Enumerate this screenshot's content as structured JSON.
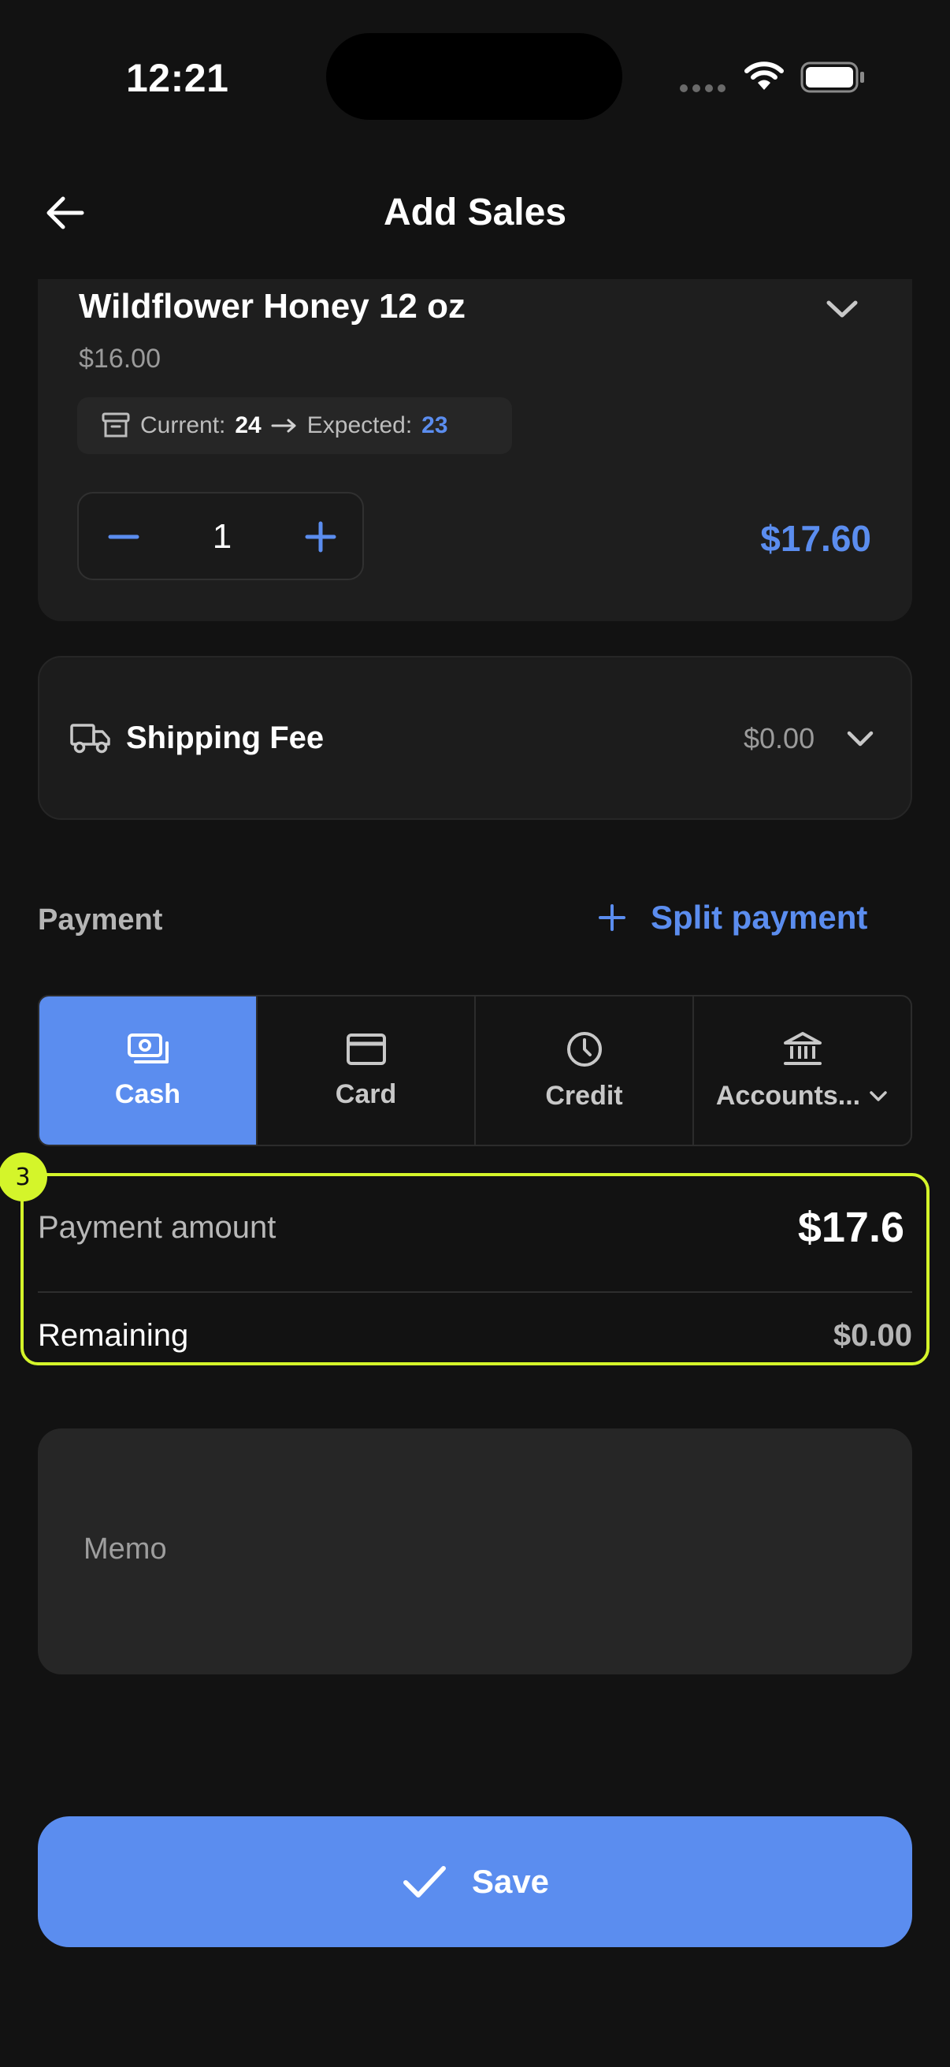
{
  "status_bar": {
    "time": "12:21",
    "icons": [
      "signal-dots-icon",
      "wifi-icon",
      "battery-icon"
    ]
  },
  "header": {
    "title": "Add Sales",
    "back_icon": "arrow-left-icon"
  },
  "product": {
    "name": "Wildflower Honey 12 oz",
    "price": "$16.00",
    "stock": {
      "current_label": "Current:",
      "current_value": "24",
      "expected_label": "Expected:",
      "expected_value": "23"
    },
    "quantity": "1",
    "line_total": "$17.60"
  },
  "shipping": {
    "label": "Shipping Fee",
    "value": "$0.00"
  },
  "payment": {
    "label": "Payment",
    "split_label": "Split payment",
    "methods": [
      {
        "label": "Cash",
        "icon": "cash-icon",
        "active": true
      },
      {
        "label": "Card",
        "icon": "card-icon",
        "active": false
      },
      {
        "label": "Credit",
        "icon": "clock-icon",
        "active": false
      },
      {
        "label": "Accounts...",
        "icon": "bank-icon",
        "active": false
      }
    ],
    "amount_label": "Payment amount",
    "amount_value": "$17.6",
    "remaining_label": "Remaining",
    "remaining_value": "$0.00",
    "highlight_badge": "3"
  },
  "memo": {
    "placeholder": "Memo"
  },
  "save": {
    "label": "Save"
  },
  "colors": {
    "accent": "#5b8def",
    "highlight": "#d4f52a",
    "background": "#121212"
  }
}
